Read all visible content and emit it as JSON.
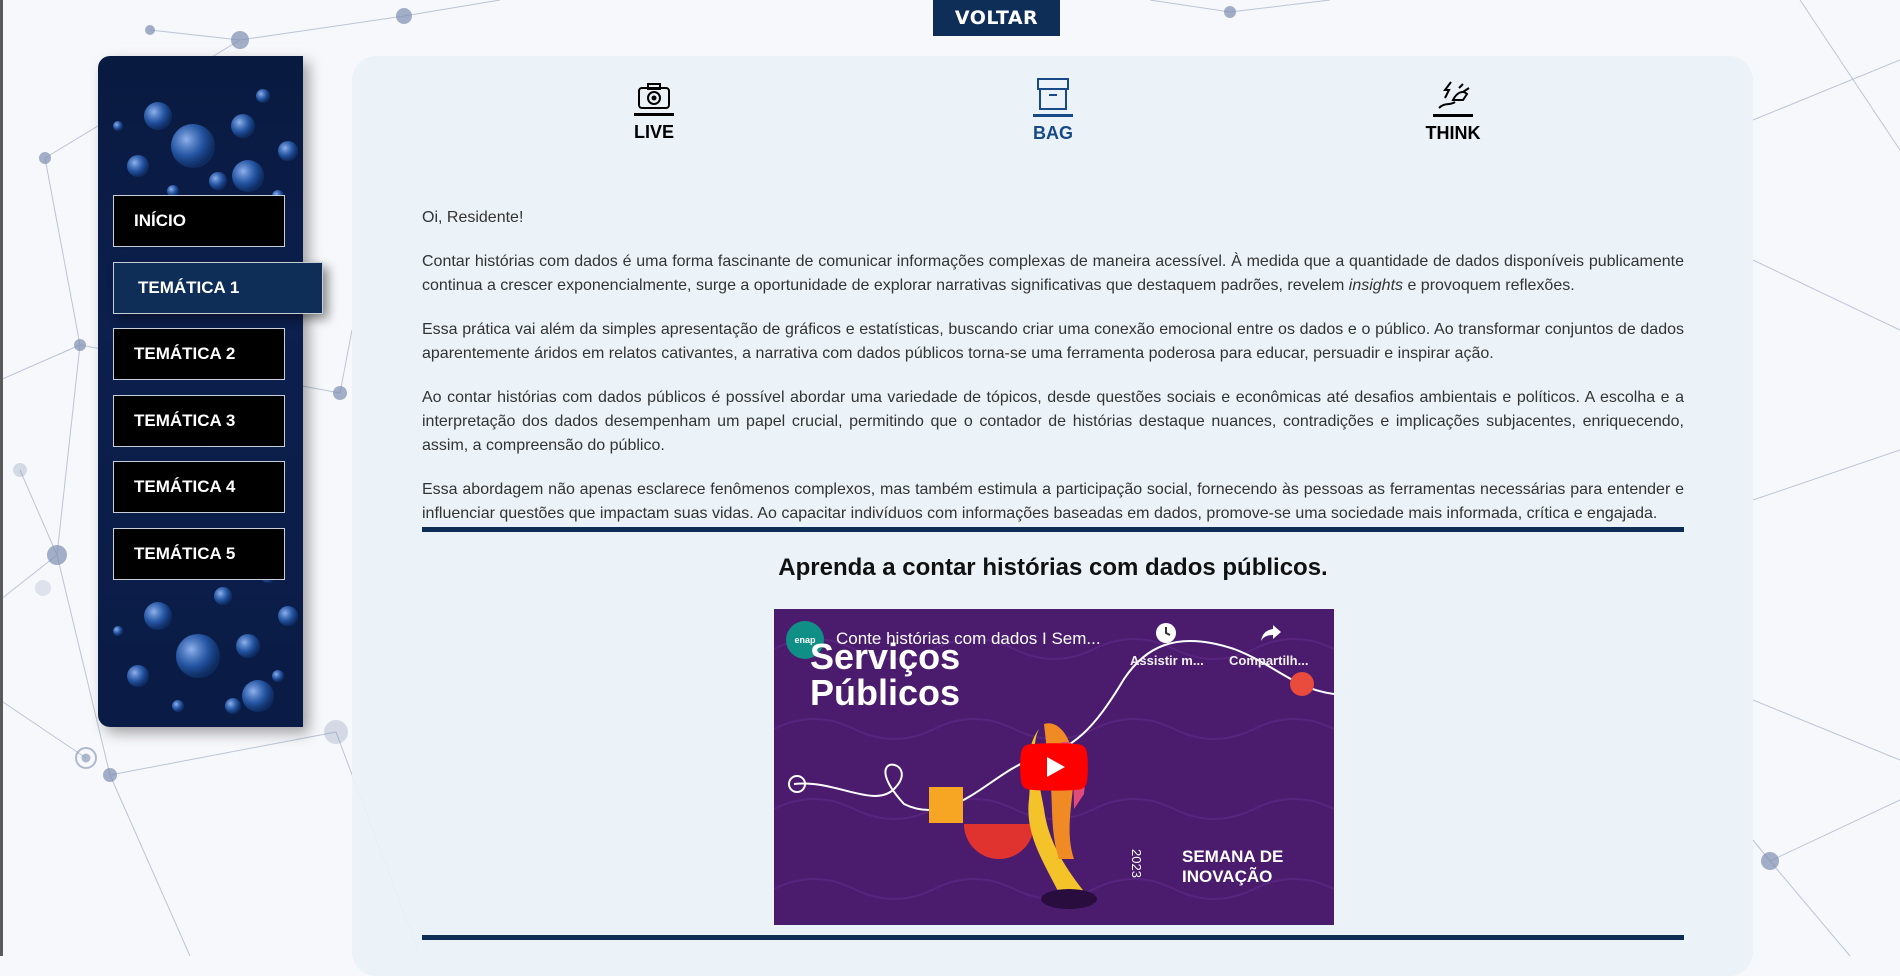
{
  "header": {
    "back_label": "VOLTAR"
  },
  "sidebar": {
    "items": [
      {
        "label": "INÍCIO",
        "active": false
      },
      {
        "label": "TEMÁTICA 1",
        "active": true
      },
      {
        "label": "TEMÁTICA 2",
        "active": false
      },
      {
        "label": "TEMÁTICA 3",
        "active": false
      },
      {
        "label": "TEMÁTICA 4",
        "active": false
      },
      {
        "label": "TEMÁTICA 5",
        "active": false
      }
    ]
  },
  "tabs": [
    {
      "label": "LIVE",
      "icon": "camera-icon",
      "active": false
    },
    {
      "label": "BAG",
      "icon": "archive-box-icon",
      "active": true
    },
    {
      "label": "THINK",
      "icon": "plug-icon",
      "active": false
    }
  ],
  "content": {
    "greeting": "Oi, Residente!",
    "p1_before": "Contar histórias com dados é uma forma fascinante de comunicar informações complexas de maneira acessível. À medida que a quantidade de dados disponíveis publicamente continua a crescer exponencialmente, surge a oportunidade de explorar narrativas significativas que destaquem padrões, revelem ",
    "p1_italic": "insights",
    "p1_after": " e provoquem reflexões.",
    "p2": "Essa prática vai além da simples apresentação de gráficos e estatísticas, buscando criar uma conexão emocional entre os dados e o público. Ao transformar conjuntos de dados aparentemente áridos em relatos cativantes, a narrativa com dados públicos torna-se uma ferramenta poderosa para educar, persuadir e inspirar ação.",
    "p3": "Ao contar histórias com dados públicos é possível abordar uma variedade de tópicos, desde questões sociais e econômicas até desafios ambientais e políticos. A escolha e a interpretação dos dados desempenham um papel crucial, permitindo que o contador de histórias destaque nuances, contradições e implicações subjacentes, enriquecendo, assim, a compreensão do público.",
    "p4": "Essa abordagem não apenas esclarece fenômenos complexos, mas também estimula a participação social, fornecendo às pessoas as ferramentas necessárias para entender e influenciar questões que impactam suas vidas. Ao capacitar indivíduos com informações baseadas em dados, promove-se uma sociedade mais informada, crítica e engajada."
  },
  "section": {
    "title": "Aprenda a contar histórias com dados públicos."
  },
  "video": {
    "channel_logo": "enap",
    "title": "Conte histórias com dados I Sem...",
    "watch_later": "Assistir m...",
    "share": "Compartilh...",
    "big_line1": "Serviços",
    "big_line2": "Públicos",
    "brand_line1": "SEMANA DE",
    "brand_line2": "INOVAÇÃO",
    "year": "2023"
  },
  "colors": {
    "navy": "#0e2d57",
    "active_tab": "#174a86",
    "youtube_red": "#ff0000"
  }
}
